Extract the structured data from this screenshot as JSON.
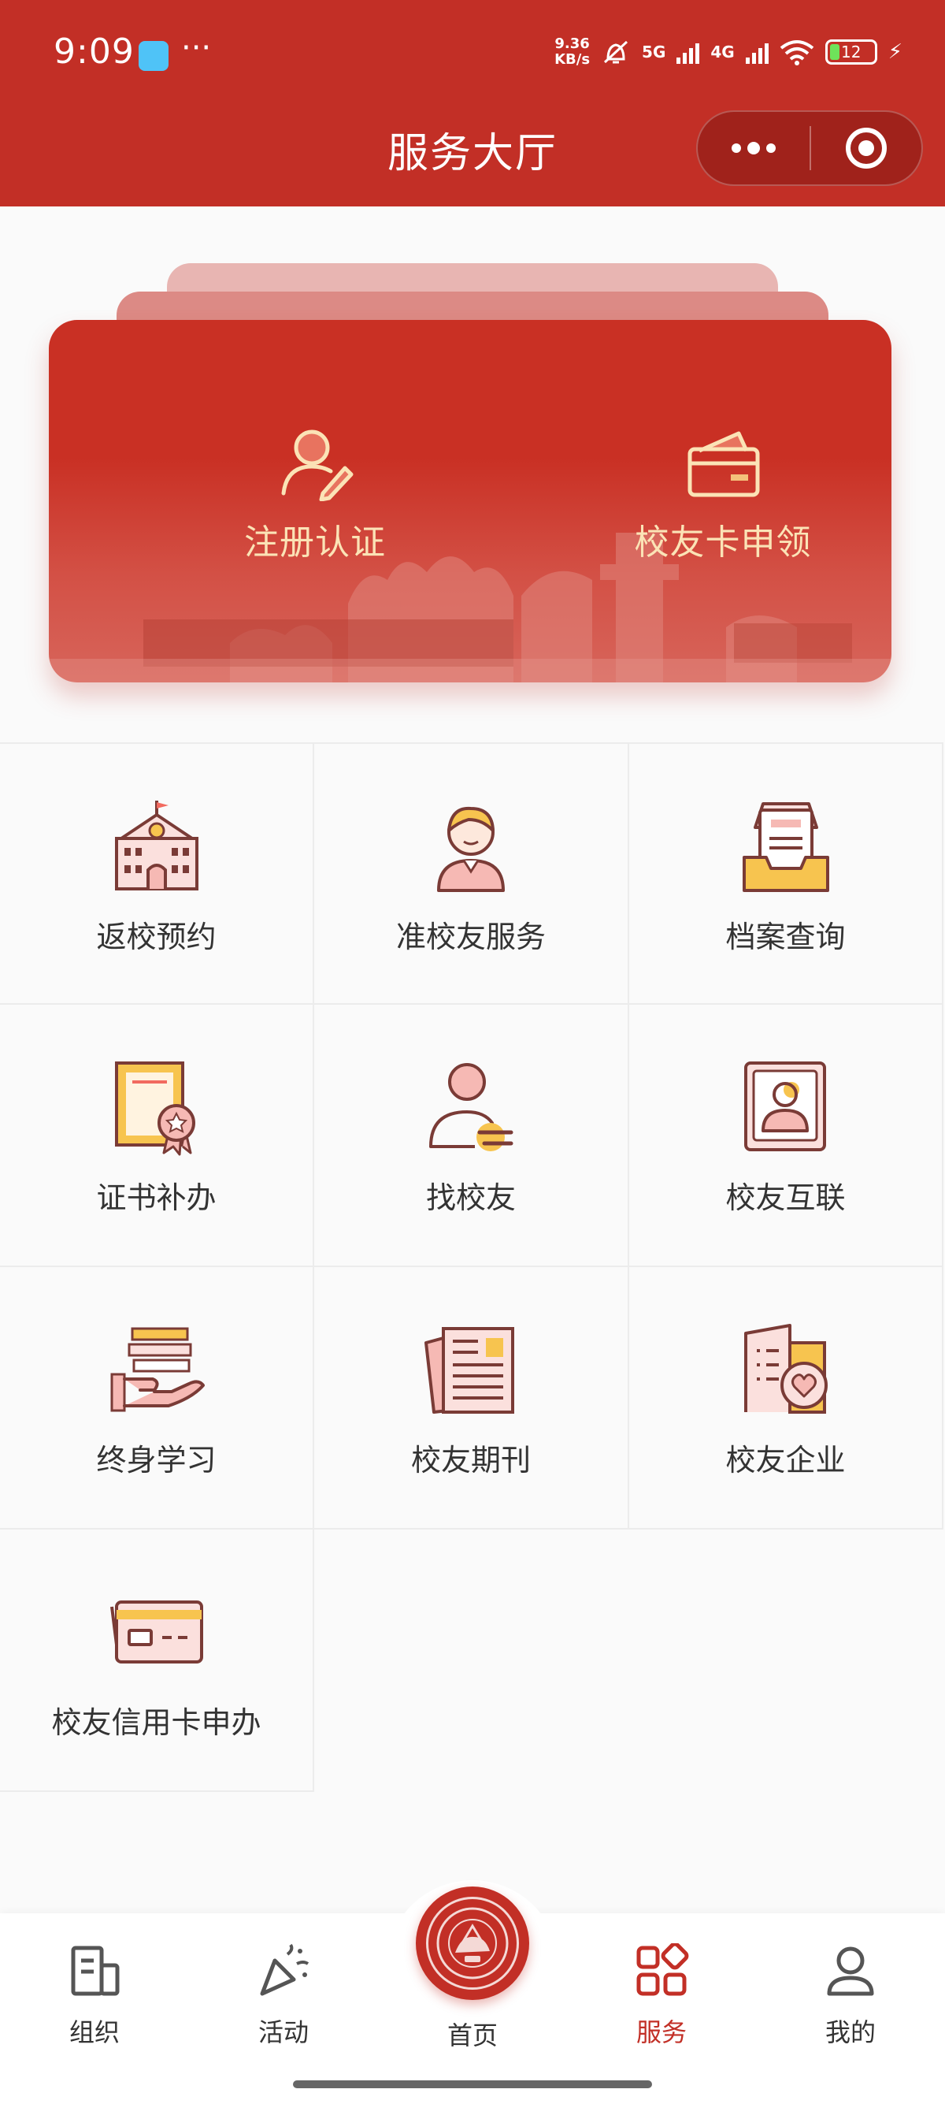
{
  "status_bar": {
    "time": "9:09",
    "more": "···",
    "net_speed_value": "9.36",
    "net_speed_unit": "KB/s",
    "signal_1": "5G",
    "signal_2": "4G",
    "battery": "12"
  },
  "header": {
    "title": "服务大厅"
  },
  "hero": {
    "left_label": "注册认证",
    "right_label": "校友卡申领"
  },
  "services": [
    {
      "label": "返校预约",
      "icon": "school-building-icon"
    },
    {
      "label": "准校友服务",
      "icon": "student-avatar-icon"
    },
    {
      "label": "档案查询",
      "icon": "archive-tray-icon"
    },
    {
      "label": "证书补办",
      "icon": "certificate-icon"
    },
    {
      "label": "找校友",
      "icon": "find-person-icon"
    },
    {
      "label": "校友互联",
      "icon": "contact-card-icon"
    },
    {
      "label": "终身学习",
      "icon": "books-hand-icon"
    },
    {
      "label": "校友期刊",
      "icon": "newspaper-icon"
    },
    {
      "label": "校友企业",
      "icon": "company-heart-icon"
    },
    {
      "label": "校友信用卡申办",
      "icon": "credit-card-icon"
    }
  ],
  "bottom_nav": {
    "items": [
      {
        "label": "组织",
        "icon": "organization-icon"
      },
      {
        "label": "活动",
        "icon": "party-popper-icon"
      },
      {
        "label": "首页",
        "icon": "university-emblem-icon"
      },
      {
        "label": "服务",
        "icon": "services-grid-icon",
        "active": true
      },
      {
        "label": "我的",
        "icon": "profile-icon"
      }
    ]
  },
  "colors": {
    "brand_red": "#c22f26",
    "hero_text": "#fbe3b6",
    "icon_outline": "#7a3b36",
    "icon_accent_pink": "#f6b9b4",
    "icon_accent_yellow": "#f7c44f"
  }
}
